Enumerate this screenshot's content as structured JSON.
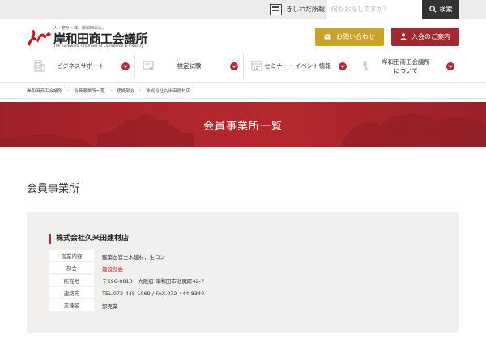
{
  "topbar": {
    "kishiwada_link": "きしわだ所報",
    "search_placeholder": "何かお探しですか？",
    "search_button": "検索"
  },
  "header": {
    "logo_tagline": "人・祭り・城。岸和田の心。",
    "logo_name": "岸和田商工会議所",
    "logo_en": "The Kishiwada Chamber of Commerce & Industry",
    "contact_button": "お問い合わせ",
    "join_button": "入会のご案内"
  },
  "nav": {
    "items": [
      {
        "label": "ビジネスサポート",
        "icon": "building-icon"
      },
      {
        "label": "検定試験",
        "icon": "certificate-icon"
      },
      {
        "label": "セミナー・イベント情報",
        "icon": "calendar-icon"
      },
      {
        "label1": "岸和田商工会議所",
        "label2": "について",
        "icon": "map-icon"
      }
    ]
  },
  "breadcrumb": [
    "岸和田商工会議所",
    "会員事業所一覧",
    "建設部会",
    "株式会社久米田建材店"
  ],
  "banner_title": "会員事業所一覧",
  "section_title": "会員事業所",
  "company": {
    "name": "株式会社久米田建材店",
    "rows": [
      {
        "key": "営業内容",
        "value": "建築左官土木建材，生コン"
      },
      {
        "key": "部会",
        "value": "建設部会"
      },
      {
        "key": "所在地",
        "value": "〒596-0813　大阪府 岸和田市池尻町42-7"
      },
      {
        "key": "連絡先",
        "value": "TEL.072-445-1069 / FAX.072-444-8340"
      },
      {
        "key": "業種名",
        "value": "卸売業"
      }
    ]
  },
  "colors": {
    "brand_red": "#a02932",
    "gold": "#c9a227",
    "dark": "#333333"
  }
}
